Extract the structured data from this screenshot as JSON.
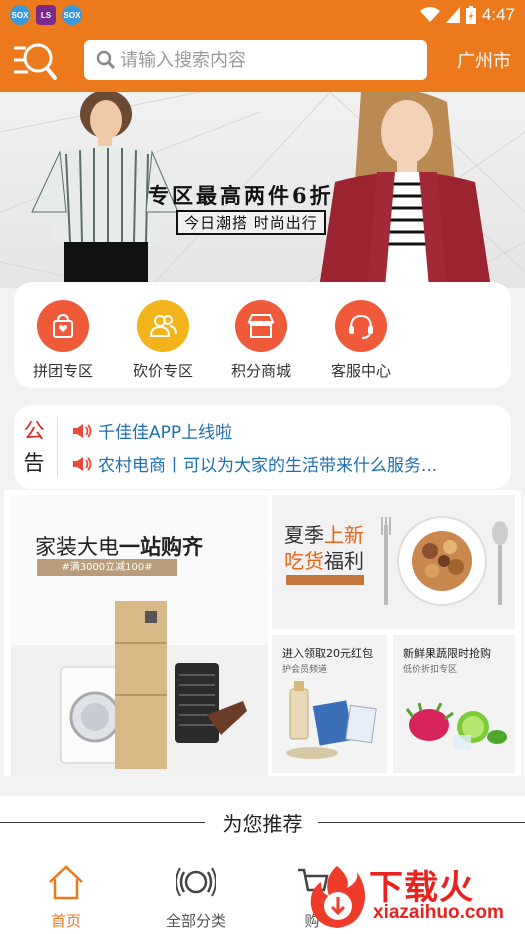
{
  "status_bar": {
    "apps": [
      "SOX",
      "LS",
      "SOX"
    ],
    "time": "4:47"
  },
  "header": {
    "search_placeholder": "请输入搜索内容",
    "city": "广州市"
  },
  "banner": {
    "headline": "专区最高两件6折",
    "sub": "今日潮搭 时尚出行"
  },
  "categories": [
    {
      "label": "拼团专区",
      "icon": "shopping-bag-icon",
      "color": "#ef5a3b"
    },
    {
      "label": "砍价专区",
      "icon": "users-icon",
      "color": "#f3b31b"
    },
    {
      "label": "积分商城",
      "icon": "store-icon",
      "color": "#ef5a3b"
    },
    {
      "label": "客服中心",
      "icon": "headset-icon",
      "color": "#ef5a3b"
    }
  ],
  "notice": {
    "tag_1": "公",
    "tag_2": "告",
    "items": [
      "千佳佳APP上线啦",
      "农村电商丨可以为大家的生活带来什么服务..."
    ]
  },
  "promos": {
    "appliance": {
      "title_plain": "家装大电",
      "title_bold": "一站购齐",
      "tag": "#满3000立减100#"
    },
    "snacks": {
      "line1_plain": "夏季",
      "line1_accent": "上新",
      "line2_accent": "吃货",
      "line2_plain": "福利"
    },
    "red_packet": {
      "title": "进入领取20元红包",
      "sub": "护会员频道"
    },
    "fruit": {
      "title": "新鲜果蔬限时抢购",
      "sub": "低价折扣专区"
    }
  },
  "recommend": {
    "title": "为您推荐"
  },
  "bottom_nav": [
    {
      "label": "首页",
      "icon": "home-icon",
      "active": true
    },
    {
      "label": "全部分类",
      "icon": "category-icon",
      "active": false
    },
    {
      "label": "购",
      "icon": "cart-icon",
      "active": false
    }
  ],
  "watermark": {
    "brand": "下载火",
    "url": "xiazaihuo.com"
  },
  "colors": {
    "accent": "#ec7a1c",
    "notice_blue": "#1d6fb3",
    "notice_red": "#d8261c"
  }
}
